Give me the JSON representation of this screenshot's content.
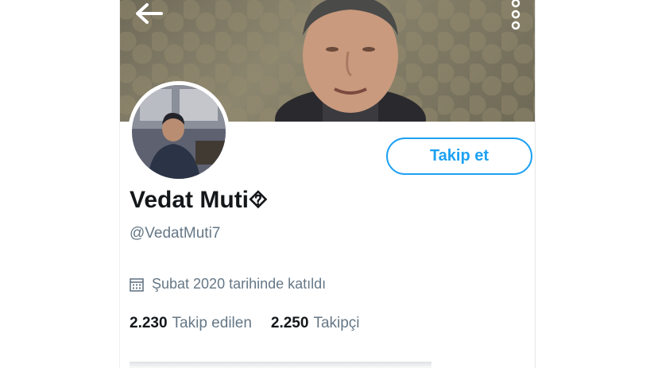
{
  "profile": {
    "display_name": "Vedat Muti⯑",
    "handle": "@VedatMuti7",
    "joined": "Şubat 2020 tarihinde katıldı",
    "following_count": "2.230",
    "following_label": "Takip edilen",
    "followers_count": "2.250",
    "followers_label": "Takipçi"
  },
  "actions": {
    "follow_label": "Takip et"
  },
  "icons": {
    "back": "back-arrow-icon",
    "more": "more-vertical-icon",
    "calendar": "calendar-icon"
  },
  "colors": {
    "accent": "#1da1f2",
    "text_primary": "#14171a",
    "text_secondary": "#657786"
  }
}
